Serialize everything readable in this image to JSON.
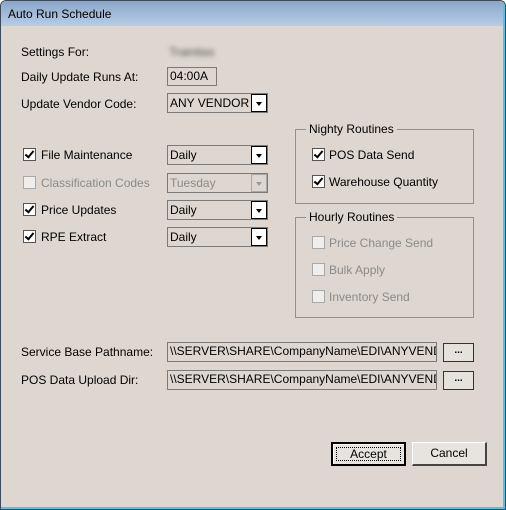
{
  "window": {
    "title": "Auto Run Schedule"
  },
  "settings": {
    "settings_for_label": "Settings For:",
    "settings_for_value": "Trainitas",
    "daily_update_label": "Daily Update Runs At:",
    "daily_update_value": "04:00A",
    "vendor_code_label": "Update Vendor Code:",
    "vendor_code_value": "ANY VENDOR"
  },
  "tasks": [
    {
      "label": "File Maintenance",
      "checked": true,
      "enabled": true,
      "schedule": "Daily"
    },
    {
      "label": "Classification Codes",
      "checked": false,
      "enabled": false,
      "schedule": "Tuesday"
    },
    {
      "label": "Price Updates",
      "checked": true,
      "enabled": true,
      "schedule": "Daily"
    },
    {
      "label": "RPE Extract",
      "checked": true,
      "enabled": true,
      "schedule": "Daily"
    }
  ],
  "nightly": {
    "title": "Nighty Routines",
    "items": [
      {
        "label": "POS Data Send",
        "checked": true,
        "enabled": true
      },
      {
        "label": "Warehouse Quantity",
        "checked": true,
        "enabled": true
      }
    ]
  },
  "hourly": {
    "title": "Hourly Routines",
    "items": [
      {
        "label": "Price Change Send",
        "checked": false,
        "enabled": false
      },
      {
        "label": "Bulk Apply",
        "checked": false,
        "enabled": false
      },
      {
        "label": "Inventory Send",
        "checked": false,
        "enabled": false
      }
    ]
  },
  "paths": {
    "service_base_label": "Service Base Pathname:",
    "service_base_value": "\\\\SERVER\\SHARE\\CompanyName\\EDI\\ANYVENDOR",
    "pos_upload_label": "POS Data Upload Dir:",
    "pos_upload_value": "\\\\SERVER\\SHARE\\CompanyName\\EDI\\ANYVENDOR",
    "browse_label": "..."
  },
  "buttons": {
    "accept": "Accept",
    "cancel": "Cancel"
  }
}
